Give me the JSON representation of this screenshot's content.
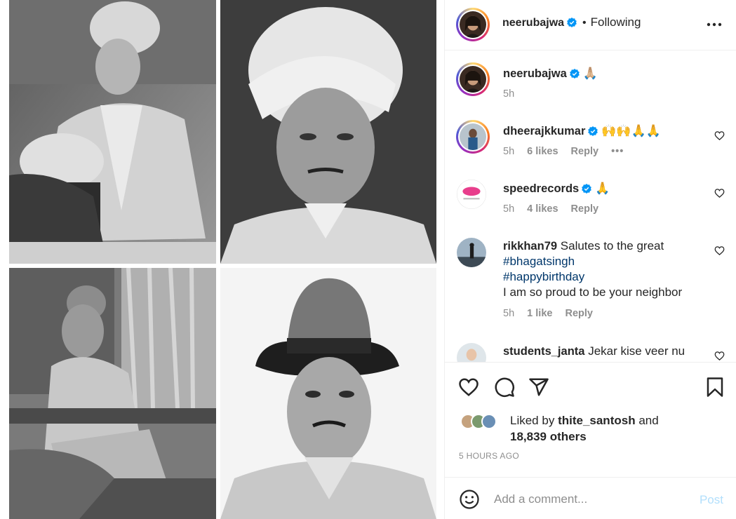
{
  "header": {
    "username": "neerubajwa",
    "separator": "•",
    "follow_label": "Following"
  },
  "caption": {
    "username": "neerubajwa",
    "text": "🙏🏼",
    "time": "5h"
  },
  "comments": [
    {
      "username": "dheerajkkumar",
      "text": "🙌🙌🙏🙏",
      "time": "5h",
      "likes": "6 likes",
      "reply": "Reply",
      "more": "•••"
    },
    {
      "username": "speedrecords",
      "text": "🙏",
      "time": "5h",
      "likes": "4 likes",
      "reply": "Reply"
    },
    {
      "username": "rikkhan79",
      "text": "Salutes to the great",
      "hashtag1": "#bhagatsingh",
      "hashtag2": "#happybirthday",
      "text2": "I am so proud to be your neighbor",
      "time": "5h",
      "likes": "1 like",
      "reply": "Reply"
    },
    {
      "username": "students_janta",
      "text": "Jekar kise veer nu"
    }
  ],
  "likes": {
    "prefix": "Liked by",
    "user": "thite_santosh",
    "and": "and",
    "others": "18,839 others"
  },
  "timestamp": "5 HOURS AGO",
  "add_comment": {
    "placeholder": "Add a comment...",
    "post_label": "Post"
  },
  "colors": {
    "verified": "#0095f6",
    "link": "#00376b",
    "post_disabled": "#b2dffc"
  },
  "icons": [
    "heart-icon",
    "comment-icon",
    "share-icon",
    "save-icon",
    "emoji-icon",
    "more-icon",
    "verified-icon"
  ]
}
